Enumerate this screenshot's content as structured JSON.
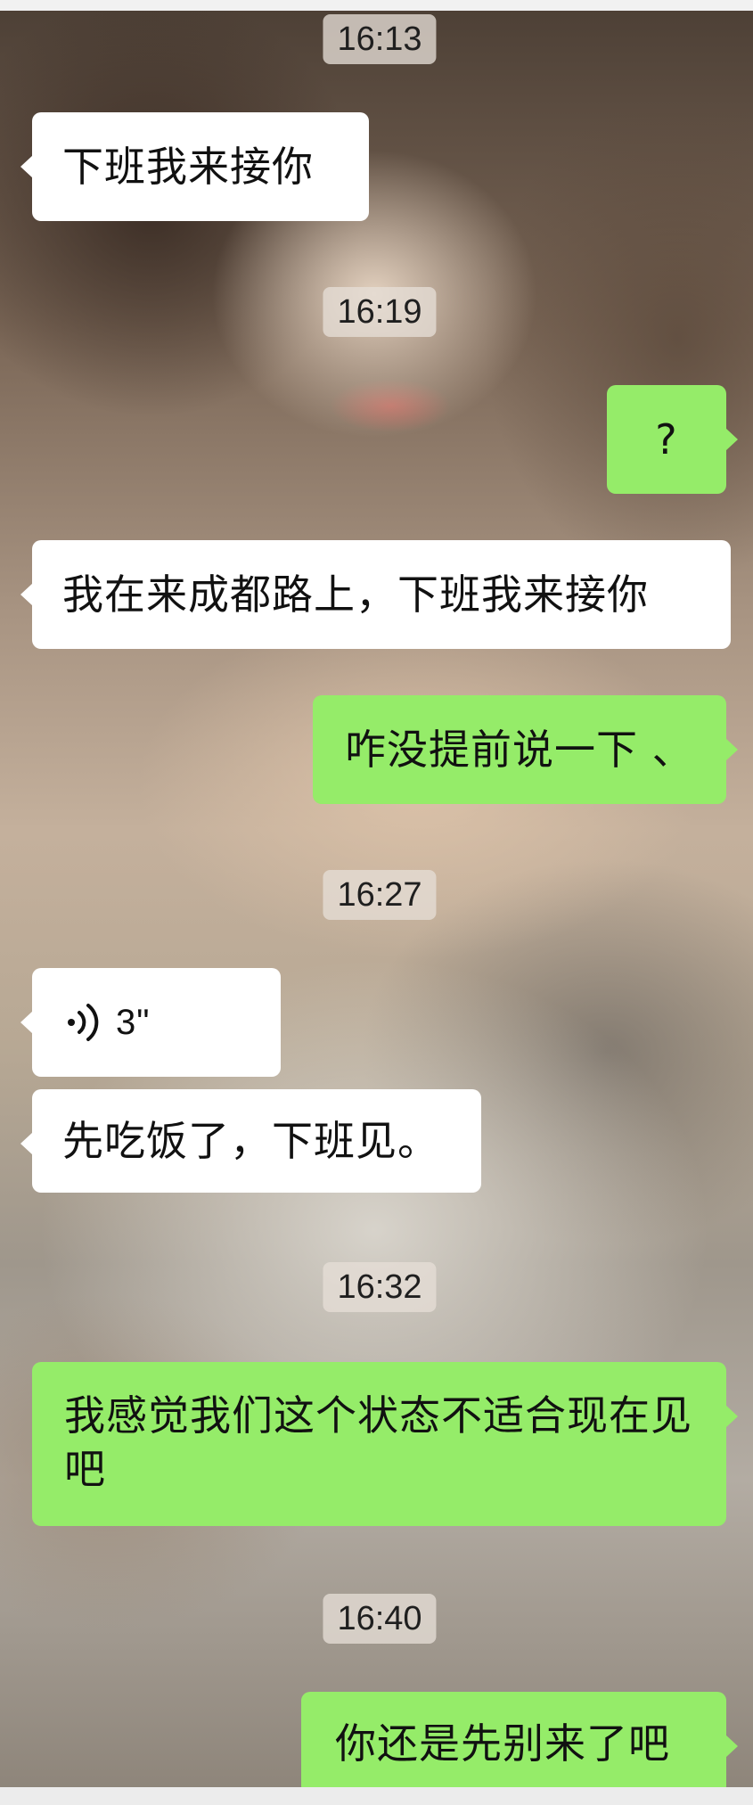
{
  "messages": [
    {
      "kind": "time",
      "text": "16:13"
    },
    {
      "kind": "in",
      "text": "下班我来接你"
    },
    {
      "kind": "time",
      "text": "16:19"
    },
    {
      "kind": "out",
      "text": "?"
    },
    {
      "kind": "in",
      "text": "我在来成都路上，下班我来接你"
    },
    {
      "kind": "out",
      "text": "咋没提前说一下 、"
    },
    {
      "kind": "time",
      "text": "16:27"
    },
    {
      "kind": "in-voice",
      "text": "3\"",
      "icon": "voice-wave-icon"
    },
    {
      "kind": "in",
      "text": "先吃饭了，下班见。"
    },
    {
      "kind": "time",
      "text": "16:32"
    },
    {
      "kind": "out",
      "text": "我感觉我们这个状态不适合现在见吧"
    },
    {
      "kind": "time",
      "text": "16:40"
    },
    {
      "kind": "out",
      "text": "你还是先别来了吧"
    }
  ],
  "colors": {
    "incoming_bubble": "#ffffff",
    "outgoing_bubble": "#95ec69",
    "timestamp_bg": "#e6ded6"
  }
}
